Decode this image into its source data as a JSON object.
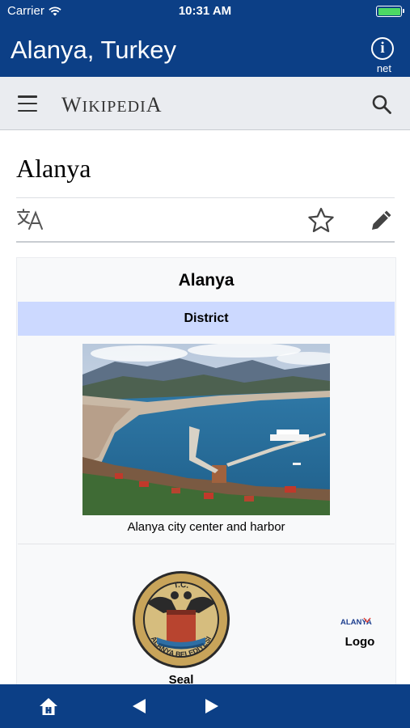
{
  "status_bar": {
    "carrier": "Carrier",
    "time": "10:31 AM",
    "battery_level": 1.0,
    "icons": [
      "wifi-icon",
      "battery-icon"
    ]
  },
  "app_header": {
    "title": "Alanya, Turkey",
    "info_glyph": "i",
    "info_sub": "net",
    "background_color": "#0c3f86"
  },
  "wiki_bar": {
    "wordmark_first": "W",
    "wordmark_middle": "IKIPEDI",
    "wordmark_last": "A",
    "icons": [
      "hamburger-menu-icon",
      "search-icon"
    ]
  },
  "article": {
    "title": "Alanya",
    "action_icons": [
      "translate-icon",
      "star-icon",
      "pencil-icon"
    ]
  },
  "infobox": {
    "title": "Alanya",
    "type_label": "District",
    "type_background": "#ccd9ff",
    "image_caption": "Alanya city center and harbor",
    "seal_label": "Seal",
    "seal_text_top": "T.C.",
    "seal_text_bottom": "ALANYA BELEDIYESI",
    "logo_text": "ALANYA",
    "logo_label": "Logo"
  },
  "bottom_bar": {
    "icons": [
      "home-icon",
      "back-arrow-icon",
      "forward-arrow-icon"
    ]
  }
}
